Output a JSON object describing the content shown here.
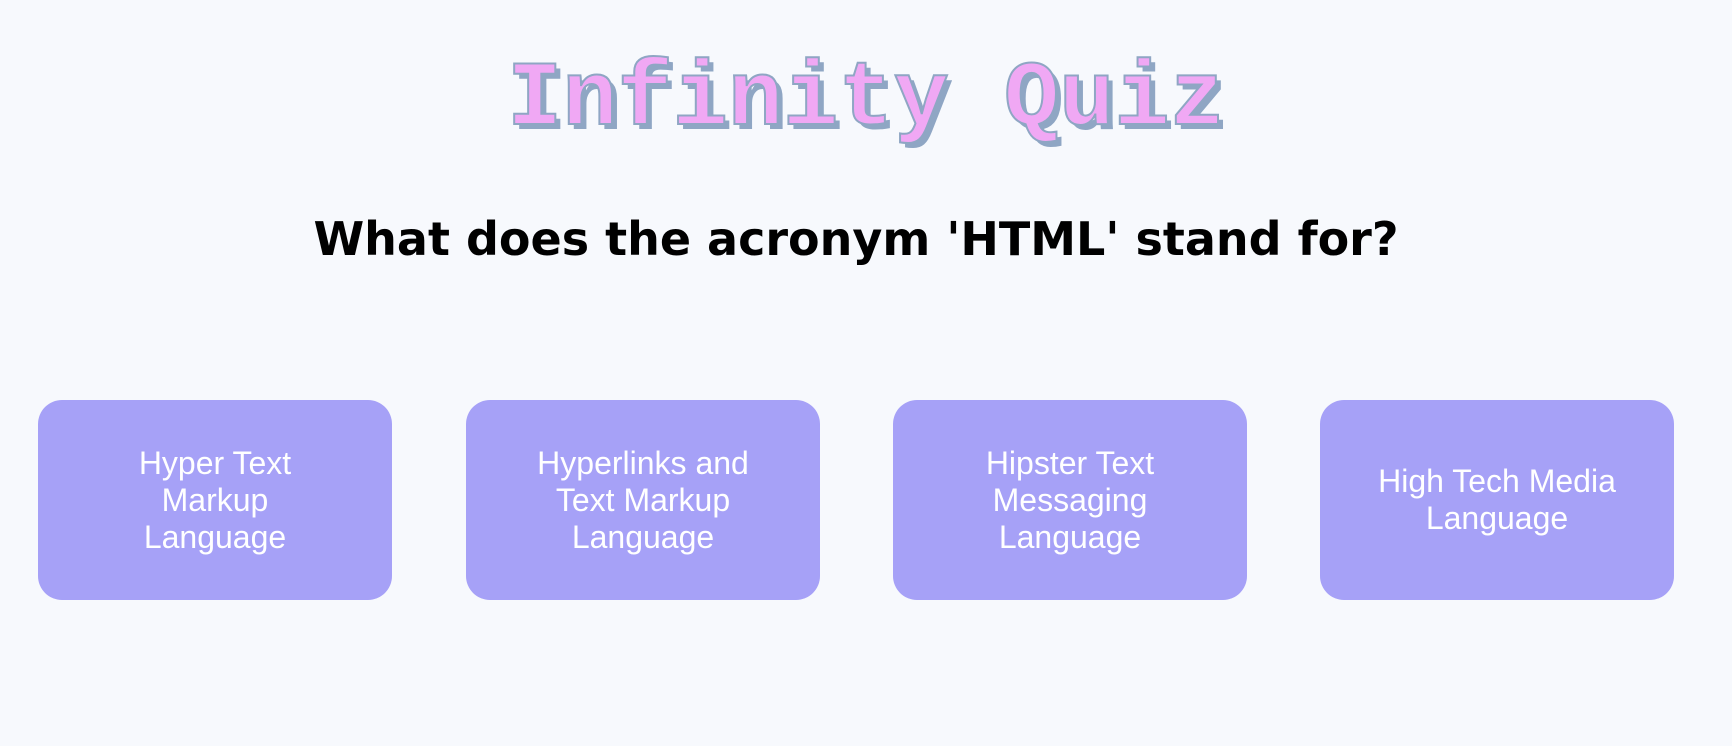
{
  "app": {
    "title": "Infinity Quiz"
  },
  "question": {
    "text": "What does the acronym 'HTML' stand for?"
  },
  "answers": [
    {
      "label": "Hyper Text Markup Language"
    },
    {
      "label": "Hyperlinks and Text Markup Language"
    },
    {
      "label": "Hipster Text Messaging Language"
    },
    {
      "label": "High Tech Media Language"
    }
  ],
  "colors": {
    "background": "#f7f9fd",
    "title_fill": "#f0a8f4",
    "title_outline": "#8fa6c4",
    "answer_button": "#a6a1f7",
    "answer_text": "#ffffff",
    "question_text": "#000000"
  }
}
